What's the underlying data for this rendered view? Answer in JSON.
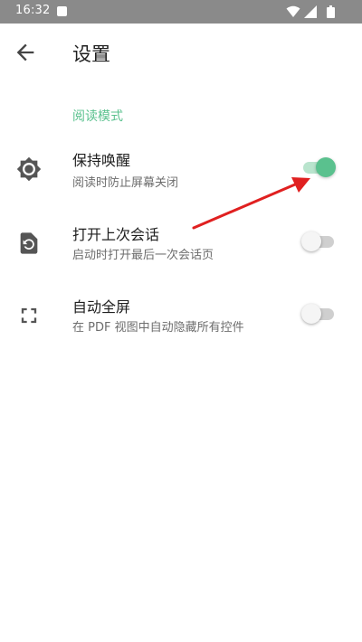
{
  "status_bar": {
    "time": "16:32",
    "icons": [
      "notification-icon",
      "wifi-icon",
      "cellular-signal-icon",
      "battery-icon"
    ]
  },
  "app_bar": {
    "title": "设置",
    "back_icon": "arrow-back-icon"
  },
  "section": {
    "header": "阅读模式",
    "items": [
      {
        "icon": "brightness-gear-icon",
        "title": "保持唤醒",
        "subtitle": "阅读时防止屏幕关闭",
        "enabled": true
      },
      {
        "icon": "restore-page-icon",
        "title": "打开上次会话",
        "subtitle": "启动时打开最后一次会话页",
        "enabled": false
      },
      {
        "icon": "fullscreen-icon",
        "title": "自动全屏",
        "subtitle": "在 PDF 视图中自动隐藏所有控件",
        "enabled": false
      }
    ]
  },
  "annotation": {
    "type": "red-arrow",
    "target": "保持唤醒 toggle"
  },
  "colors": {
    "accent": "#5ac18e",
    "accent_track": "#b9e4cd",
    "status_bar": "#8a8a8a",
    "annotation_arrow": "#e02020",
    "icon": "#555555"
  }
}
